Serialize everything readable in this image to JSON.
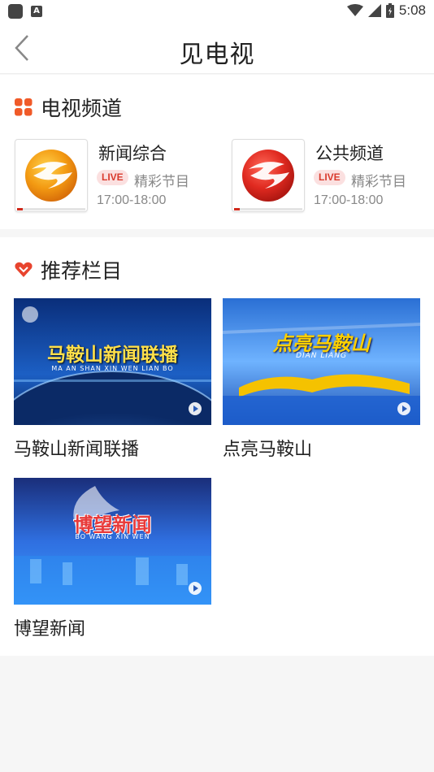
{
  "status_bar": {
    "time": "5:08"
  },
  "header": {
    "title": "见电视"
  },
  "tv_section": {
    "title": "电视频道",
    "channels": [
      {
        "name": "新闻综合",
        "live": "LIVE",
        "program": "精彩节目",
        "time": "17:00-18:00",
        "progress": 0.08,
        "logo_color": "#f08a0c"
      },
      {
        "name": "公共频道",
        "live": "LIVE",
        "program": "精彩节目",
        "time": "17:00-18:00",
        "progress": 0.08,
        "logo_color": "#d9261c"
      }
    ]
  },
  "rec_section": {
    "title": "推荐栏目",
    "programs": [
      {
        "title": "马鞍山新闻联播",
        "banner": "马鞍山新闻联播",
        "sub": "MA AN SHAN XIN WEN LIAN BO"
      },
      {
        "title": "点亮马鞍山",
        "banner": "点亮马鞍山",
        "sub": "DIAN LIANG"
      },
      {
        "title": "博望新闻",
        "banner": "博望新闻",
        "sub": "BO WANG XIN WEN"
      }
    ]
  },
  "colors": {
    "accent": "#d93a2d",
    "grid_icon": "#f05a28",
    "heart_icon": "#e8442e"
  }
}
